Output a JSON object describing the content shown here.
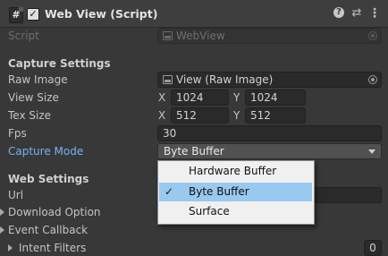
{
  "component": {
    "title": "Web View (Script)",
    "enabled": true
  },
  "script_field": {
    "label": "Script",
    "value": "WebView"
  },
  "capture": {
    "section_label": "Capture Settings",
    "raw_image": {
      "label": "Raw Image",
      "value": "View (Raw Image)"
    },
    "view_size": {
      "label": "View Size",
      "x_label": "X",
      "x": "1024",
      "y_label": "Y",
      "y": "1024"
    },
    "tex_size": {
      "label": "Tex Size",
      "x_label": "X",
      "x": "512",
      "y_label": "Y",
      "y": "512"
    },
    "fps": {
      "label": "Fps",
      "value": "30"
    },
    "capture_mode": {
      "label": "Capture Mode",
      "value": "Byte Buffer",
      "options": [
        {
          "label": "Hardware Buffer",
          "selected": false
        },
        {
          "label": "Byte Buffer",
          "selected": true
        },
        {
          "label": "Surface",
          "selected": false
        }
      ],
      "check_glyph": "✓"
    }
  },
  "web": {
    "section_label": "Web Settings",
    "url": {
      "label": "Url",
      "value": ""
    },
    "download_option": {
      "label": "Download Option"
    },
    "event_callback": {
      "label": "Event Callback"
    },
    "intent_filters": {
      "label": "Intent Filters",
      "count": "0"
    }
  },
  "icons": {
    "script": "#",
    "check": "✓",
    "help": "?",
    "settings": "⇄",
    "more": "⋮"
  },
  "colors": {
    "background": "#383838",
    "header": "#3e3e3e",
    "highlight_label": "#7ab0f5",
    "popup_background": "#f0f0f0",
    "popup_selected": "#99c9ef"
  }
}
